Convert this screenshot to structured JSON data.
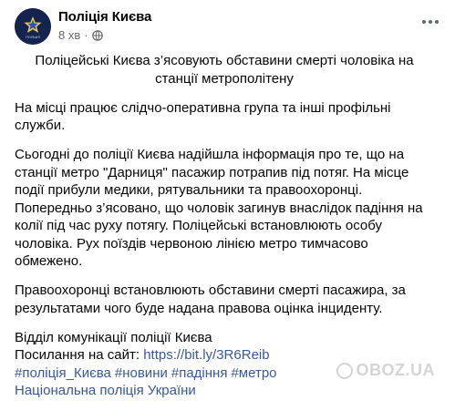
{
  "post": {
    "author": "Поліція Києва",
    "time": "8 хв",
    "meta_separator": "·",
    "audience_icon": "globe-icon",
    "more_icon": "more-options-icon",
    "headline": "Поліцейські Києва з’ясовують обставини смерті чоловіка на станції метрополітену",
    "paragraph_1": "На місці працює слідчо-оперативна група та інші профільні служби.",
    "paragraph_2": "Сьогодні до поліції Києва надійшла інформація про те, що на станції метро \"Дарниця\" пасажир потрапив під потяг. На місце події прибули медики, рятувальники та правоохоронці. Попередньо з’ясовано, що чоловік загинув внаслідок падіння на колії під час  руху потягу. Поліцейські встановлюють особу чоловіка. Рух поїздів червоною лінією метро тимчасово обмежено.",
    "paragraph_3": "Правоохоронці встановлюють обставини смерті пасажира, за результатами чого буде надана правова оцінка інциденту.",
    "signature": "Відділ комунікації поліції Києва",
    "site_label": "Посилання на сайт: ",
    "site_link": "https://bit.ly/3R6Reib",
    "hashtags": [
      "#поліція_Києва",
      "#новини",
      "#падіння",
      "#метро"
    ],
    "org_link": "Національна поліція України"
  },
  "watermark": {
    "text": "OBOZ.UA"
  },
  "colors": {
    "link": "#385898",
    "meta": "#65676b",
    "text": "#050505",
    "avatar_bg": "#15234f"
  }
}
